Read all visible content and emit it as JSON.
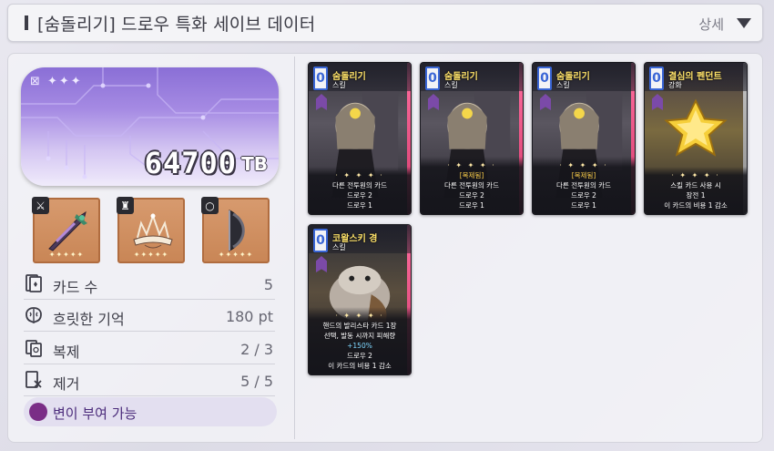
{
  "header": {
    "title": "[숨돌리기] 드로우 특화 세이브 데이터",
    "detail_label": "상세"
  },
  "currency": {
    "amount": "64700",
    "unit": "TB"
  },
  "equipment": [
    {
      "slot_icon": "weapon-icon",
      "item": "dagger",
      "stars": "✦✦✦✦✦"
    },
    {
      "slot_icon": "armor-icon",
      "item": "crown",
      "stars": "✦✦✦✦✦"
    },
    {
      "slot_icon": "ring-icon",
      "item": "shield",
      "stars": "✦✦✦✦✦"
    }
  ],
  "stats": [
    {
      "label": "카드 수",
      "value": "5"
    },
    {
      "label": "흐릿한 기억",
      "value": "180 pt"
    },
    {
      "label": "복제",
      "value": "2 / 3"
    },
    {
      "label": "제거",
      "value": "5 / 5"
    }
  ],
  "mutation_label": "변이 부여 가능",
  "cards": [
    {
      "cost": "0",
      "name": "숨돌리기",
      "type": "스킬",
      "tag": "",
      "desc": [
        "다른 전투원의 카드",
        "드로우 2",
        "드로우 1"
      ]
    },
    {
      "cost": "0",
      "name": "숨돌리기",
      "type": "스킬",
      "tag": "[복제됨]",
      "desc": [
        "다른 전투원의 카드",
        "드로우 2",
        "드로우 1"
      ]
    },
    {
      "cost": "0",
      "name": "숨돌리기",
      "type": "스킬",
      "tag": "[복제됨]",
      "desc": [
        "다른 전투원의 카드",
        "드로우 2",
        "드로우 1"
      ]
    },
    {
      "cost": "0",
      "name": "결심의 펜던트",
      "type": "강화",
      "tag": "",
      "desc": [
        "스킬 카드 사용 시",
        "장전 1",
        "이 카드의 비용 1 감소"
      ]
    },
    {
      "cost": "0",
      "name": "코왈스키 경",
      "type": "스킬",
      "tag": "",
      "desc": [
        "핸드의 발리스타 카드 1장",
        "선택, 발동 시까지 피해량",
        "+150%",
        "드로우 2",
        "이 카드의 비용 1 감소"
      ]
    }
  ],
  "colors": {
    "accent_blue": "#3a66d6",
    "card_name_yellow": "#ffe36a",
    "equip_bronze": "#d79a6e",
    "currency_purple": "#8a6fd6",
    "mutation_purple": "#7a2d86"
  }
}
